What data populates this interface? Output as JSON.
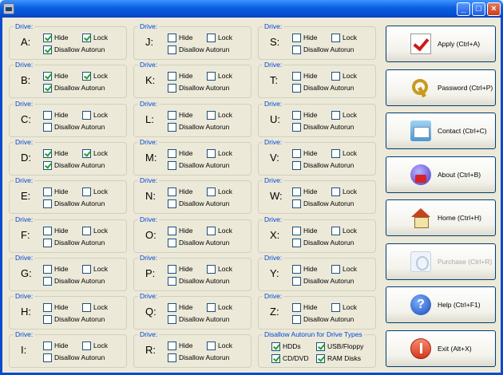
{
  "window": {
    "minimize_glyph": "_",
    "maximize_glyph": "□",
    "close_glyph": "×"
  },
  "drive_legend": "Drive:",
  "labels": {
    "hide": "Hide",
    "lock": "Lock",
    "disallow": "Disallow Autorun"
  },
  "drives": [
    {
      "letter": "A:",
      "hide": true,
      "lock": true,
      "disallow": true
    },
    {
      "letter": "B:",
      "hide": true,
      "lock": true,
      "disallow": true
    },
    {
      "letter": "C:",
      "hide": false,
      "lock": false,
      "disallow": false
    },
    {
      "letter": "D:",
      "hide": true,
      "lock": true,
      "disallow": true
    },
    {
      "letter": "E:",
      "hide": false,
      "lock": false,
      "disallow": false
    },
    {
      "letter": "F:",
      "hide": false,
      "lock": false,
      "disallow": false
    },
    {
      "letter": "G:",
      "hide": false,
      "lock": false,
      "disallow": false
    },
    {
      "letter": "H:",
      "hide": false,
      "lock": false,
      "disallow": false
    },
    {
      "letter": "I:",
      "hide": false,
      "lock": false,
      "disallow": false
    },
    {
      "letter": "J:",
      "hide": false,
      "lock": false,
      "disallow": false
    },
    {
      "letter": "K:",
      "hide": false,
      "lock": false,
      "disallow": false
    },
    {
      "letter": "L:",
      "hide": false,
      "lock": false,
      "disallow": false
    },
    {
      "letter": "M:",
      "hide": false,
      "lock": false,
      "disallow": false
    },
    {
      "letter": "N:",
      "hide": false,
      "lock": false,
      "disallow": false
    },
    {
      "letter": "O:",
      "hide": false,
      "lock": false,
      "disallow": false
    },
    {
      "letter": "P:",
      "hide": false,
      "lock": false,
      "disallow": false
    },
    {
      "letter": "Q:",
      "hide": false,
      "lock": false,
      "disallow": false
    },
    {
      "letter": "R:",
      "hide": false,
      "lock": false,
      "disallow": false
    },
    {
      "letter": "S:",
      "hide": false,
      "lock": false,
      "disallow": false
    },
    {
      "letter": "T:",
      "hide": false,
      "lock": false,
      "disallow": false
    },
    {
      "letter": "U:",
      "hide": false,
      "lock": false,
      "disallow": false
    },
    {
      "letter": "V:",
      "hide": false,
      "lock": false,
      "disallow": false
    },
    {
      "letter": "W:",
      "hide": false,
      "lock": false,
      "disallow": false
    },
    {
      "letter": "X:",
      "hide": false,
      "lock": false,
      "disallow": false
    },
    {
      "letter": "Y:",
      "hide": false,
      "lock": false,
      "disallow": false
    },
    {
      "letter": "Z:",
      "hide": false,
      "lock": false,
      "disallow": false
    }
  ],
  "drive_types": {
    "legend": "Disallow Autorun for Drive Types",
    "hdds": {
      "label": "HDDs",
      "checked": true
    },
    "usb": {
      "label": "USB/Floppy",
      "checked": true
    },
    "cddvd": {
      "label": "CD/DVD",
      "checked": true
    },
    "ram": {
      "label": "RAM Disks",
      "checked": true
    }
  },
  "buttons": [
    {
      "label": "Apply (Ctrl+A)",
      "icon": "apply-icon",
      "enabled": true
    },
    {
      "label": "Password (Ctrl+P)",
      "icon": "keys-icon",
      "enabled": true
    },
    {
      "label": "Contact (Ctrl+C)",
      "icon": "contact-icon",
      "enabled": true
    },
    {
      "label": "About (Ctrl+B)",
      "icon": "about-icon",
      "enabled": true
    },
    {
      "label": "Home (Ctrl+H)",
      "icon": "home-icon",
      "enabled": true
    },
    {
      "label": "Purchase (Ctrl+R)",
      "icon": "purchase-icon",
      "enabled": false
    },
    {
      "label": "Help (Ctrl+F1)",
      "icon": "help-icon",
      "enabled": true,
      "glyph": "?"
    },
    {
      "label": "Exit (Alt+X)",
      "icon": "exit-icon",
      "enabled": true
    }
  ]
}
